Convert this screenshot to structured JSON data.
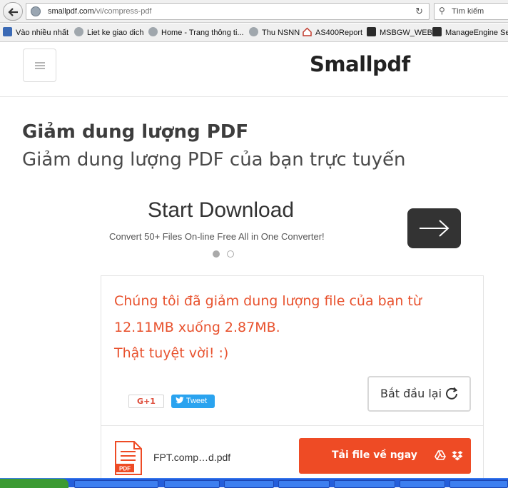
{
  "browser": {
    "url_domain": "smallpdf.com",
    "url_path": "/vi/compress-pdf",
    "search_placeholder": "Tìm kiếm",
    "bookmarks": [
      {
        "label": "Vào nhiều nhất",
        "icon": "search-page-icon"
      },
      {
        "label": "Liet ke giao dich",
        "icon": "globe-icon"
      },
      {
        "label": "Home - Trang thông ti...",
        "icon": "globe-icon"
      },
      {
        "label": "Thu NSNN",
        "icon": "globe-icon"
      },
      {
        "label": "AS400Report",
        "icon": "house-icon"
      },
      {
        "label": "MSBGW_WEB",
        "icon": "app-icon"
      },
      {
        "label": "ManageEngine Se",
        "icon": "app-icon"
      }
    ]
  },
  "header": {
    "logo": "Smallpdf"
  },
  "page": {
    "title": "Giảm dung lượng PDF",
    "subtitle": "Giảm dung lượng PDF của bạn trực tuyến"
  },
  "ad": {
    "title": "Start Download",
    "description": "Convert 50+ Files On-line Free All in One Converter!",
    "active_slide": 1,
    "total_slides": 2
  },
  "result": {
    "message_lines": [
      "Chúng tôi đã giảm dung lượng file của bạn từ",
      "12.11MB xuống 2.87MB.",
      "Thật tuyệt vời! :)"
    ],
    "gplus_label": "G+1",
    "tweet_label": "Tweet",
    "restart_label": "Bắt đầu lại",
    "file_name": "FPT.comp…d.pdf",
    "file_type_label": "PDF",
    "download_label": "Tải file về ngay"
  },
  "colors": {
    "accent": "#ee4b25",
    "message": "#e8522e",
    "tweet": "#2aa3ef"
  }
}
